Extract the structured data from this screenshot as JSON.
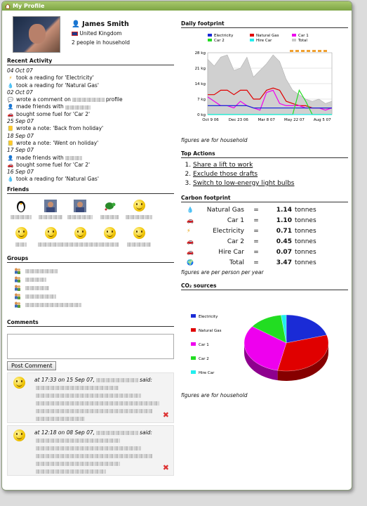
{
  "window": {
    "title": "My Profile"
  },
  "profile": {
    "name": "James Smith",
    "country": "United Kingdom",
    "household": "2 people in household"
  },
  "recent_activity": {
    "heading": "Recent Activity",
    "items": [
      {
        "type": "date",
        "text": "04 Oct 07"
      },
      {
        "type": "item",
        "icon": "lightning-icon",
        "text": "took a reading for 'Electricity'"
      },
      {
        "type": "item",
        "icon": "droplet-icon",
        "text": "took a reading for 'Natural Gas'"
      },
      {
        "type": "date",
        "text": "02 Oct 07"
      },
      {
        "type": "item",
        "icon": "speech-bubble-icon",
        "text": "wrote a comment on",
        "blur": 46,
        "text2": "profile"
      },
      {
        "type": "item",
        "icon": "person-icon",
        "text": "made friends with",
        "blur": 36
      },
      {
        "type": "item",
        "icon": "car-icon",
        "text": "bought some fuel for 'Car 2'"
      },
      {
        "type": "date",
        "text": "25 Sep 07"
      },
      {
        "type": "item",
        "icon": "note-icon",
        "text": "wrote a note: 'Back from holiday'"
      },
      {
        "type": "date",
        "text": "18 Sep 07"
      },
      {
        "type": "item",
        "icon": "note-icon",
        "text": "wrote a note: 'Went on holiday'"
      },
      {
        "type": "date",
        "text": "17 Sep 07"
      },
      {
        "type": "item",
        "icon": "person-icon",
        "text": "made friends with",
        "blur": 24
      },
      {
        "type": "item",
        "icon": "car-icon",
        "text": "bought some fuel for 'Car 2'"
      },
      {
        "type": "date",
        "text": "16 Sep 07"
      },
      {
        "type": "item",
        "icon": "droplet-icon",
        "text": "took a reading for 'Natural Gas'"
      }
    ]
  },
  "friends": {
    "heading": "Friends",
    "items": [
      {
        "icon": "penguin-icon",
        "bw": 30
      },
      {
        "icon": "photo-icon",
        "bw": 34
      },
      {
        "icon": "photo-icon",
        "bw": 36
      },
      {
        "icon": "turtle-icon",
        "bw": 26
      },
      {
        "icon": "smiley-icon",
        "bw": 38
      },
      {
        "icon": "smiley-icon",
        "bw": 16
      },
      {
        "icon": "smiley-icon",
        "bw": 36
      },
      {
        "icon": "smiley-icon",
        "bw": 58
      },
      {
        "icon": "smiley-icon",
        "bw": 26
      },
      {
        "icon": "smiley-icon",
        "bw": 34
      }
    ]
  },
  "groups": {
    "heading": "Groups",
    "items": [
      {
        "bw": 46
      },
      {
        "bw": 30
      },
      {
        "bw": 34
      },
      {
        "bw": 44
      },
      {
        "bw": 80
      }
    ]
  },
  "comments": {
    "heading": "Comments",
    "post_label": "Post Comment",
    "items": [
      {
        "time": "at 17:33 on 15 Sep 07,",
        "said": "said:",
        "lines": [
          118,
          150,
          176,
          166,
          70
        ]
      },
      {
        "time": "at 12:18 on 08 Sep 07,",
        "said": "said:",
        "lines": [
          120,
          150,
          166,
          120,
          100
        ]
      }
    ]
  },
  "daily": {
    "heading": "Daily footprint",
    "note": "figures are for household"
  },
  "top_actions": {
    "heading": "Top Actions",
    "items": [
      "Share a lift to work",
      "Exclude those drafts",
      "Switch to low-energy light bulbs"
    ]
  },
  "carbon": {
    "heading": "Carbon footprint",
    "rows": [
      {
        "icon": "droplet-icon",
        "label": "Natural Gas",
        "eq": "=",
        "value": "1.14",
        "unit": "tonnes"
      },
      {
        "icon": "car-icon",
        "label": "Car 1",
        "eq": "=",
        "value": "1.10",
        "unit": "tonnes"
      },
      {
        "icon": "lightning-icon",
        "label": "Electricity",
        "eq": "=",
        "value": "0.71",
        "unit": "tonnes"
      },
      {
        "icon": "car-icon",
        "label": "Car 2",
        "eq": "=",
        "value": "0.45",
        "unit": "tonnes"
      },
      {
        "icon": "car-icon",
        "label": "Hire Car",
        "eq": "=",
        "value": "0.07",
        "unit": "tonnes"
      },
      {
        "icon": "globe-icon",
        "label": "Total",
        "eq": "=",
        "value": "3.47",
        "unit": "tonnes"
      }
    ],
    "note": "figures are per person per year"
  },
  "co2": {
    "heading": "CO₂ sources",
    "note": "figures are for household"
  },
  "chart_data": [
    {
      "type": "line",
      "title": "Daily footprint",
      "x_ticks": [
        "Oct 9 06",
        "Dec 23 06",
        "Mar 8 07",
        "May 22 07",
        "Aug 5 07"
      ],
      "y_ticks": [
        "0 kg",
        "7 kg",
        "14 kg",
        "21 kg",
        "28 kg"
      ],
      "ylim": [
        0,
        28
      ],
      "legend": [
        "Electricity",
        "Natural Gas",
        "Car 1",
        "Car 2",
        "Hire Car",
        "Total"
      ],
      "colors": {
        "Electricity": "#1a2bd6",
        "Natural Gas": "#e00000",
        "Car 1": "#ee00ee",
        "Car 2": "#22dd22",
        "Hire Car": "#22eeee",
        "Total": "#c8c8c8"
      },
      "series": [
        {
          "name": "Total",
          "values": [
            25,
            22,
            26,
            27,
            20,
            21,
            26,
            17,
            20,
            23,
            27,
            24,
            16,
            11,
            9,
            7,
            6,
            7,
            5,
            6
          ]
        },
        {
          "name": "Natural Gas",
          "values": [
            9,
            9,
            11,
            11,
            9,
            11,
            11,
            7,
            7,
            11,
            12,
            11,
            6,
            5,
            4,
            4,
            3,
            3,
            3,
            3
          ]
        },
        {
          "name": "Car 1",
          "values": [
            8,
            6,
            4,
            4,
            3,
            6,
            4,
            3,
            2,
            10,
            11,
            5,
            4,
            4,
            4,
            3,
            3,
            3,
            2,
            3
          ]
        },
        {
          "name": "Electricity",
          "values": [
            4,
            4,
            4,
            4,
            4,
            4,
            4,
            3,
            3,
            3,
            3,
            3,
            3,
            3,
            3,
            3,
            3,
            3,
            3,
            3
          ]
        },
        {
          "name": "Car 2",
          "values": [
            0,
            0,
            0,
            0,
            0,
            0,
            0,
            0,
            0,
            0,
            0,
            0,
            0,
            0,
            11,
            6,
            0,
            0,
            0,
            0
          ]
        },
        {
          "name": "Hire Car",
          "values": [
            0,
            0,
            0,
            0,
            0,
            0,
            0,
            0,
            0,
            0,
            0,
            0,
            0,
            0,
            0,
            0,
            0,
            0,
            0,
            0
          ]
        }
      ]
    },
    {
      "type": "pie",
      "title": "CO₂ sources",
      "legend": [
        "Electricity",
        "Natural Gas",
        "Car 1",
        "Car 2",
        "Hire Car"
      ],
      "values": [
        0.71,
        1.14,
        1.1,
        0.45,
        0.07
      ],
      "colors": [
        "#1a2bd6",
        "#e00000",
        "#ee00ee",
        "#22dd22",
        "#22eeee"
      ]
    }
  ]
}
